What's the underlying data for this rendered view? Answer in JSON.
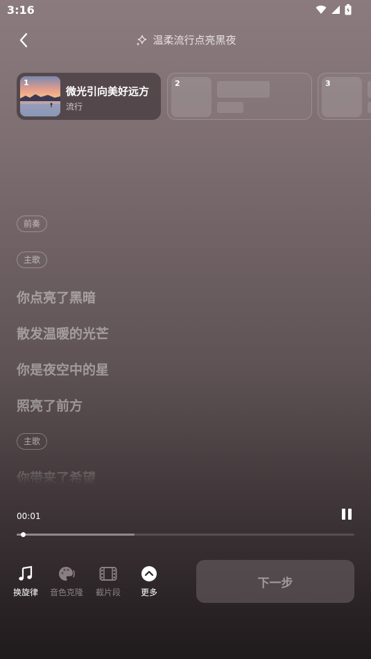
{
  "status_bar": {
    "time": "3:16"
  },
  "header": {
    "title": "温柔流行点亮黑夜"
  },
  "song_cards": [
    {
      "number": "1",
      "title": "微光引向美好远方",
      "genre": "流行"
    },
    {
      "number": "2"
    },
    {
      "number": "3"
    }
  ],
  "lyrics": [
    {
      "type": "tag",
      "text": "前奏"
    },
    {
      "type": "tag",
      "text": "主歌"
    },
    {
      "type": "line",
      "text": "你点亮了黑暗"
    },
    {
      "type": "line",
      "text": "散发温暖的光芒"
    },
    {
      "type": "line",
      "text": "你是夜空中的星"
    },
    {
      "type": "line",
      "text": "照亮了前方"
    },
    {
      "type": "tag",
      "text": "主歌"
    },
    {
      "type": "line",
      "text": "你带来了希望"
    }
  ],
  "player": {
    "current_time": "00:01",
    "progress_fraction": 0.35,
    "playhead_fraction": 0.012
  },
  "toolbar": [
    {
      "label": "换旋律",
      "icon": "music-note-icon",
      "active": true
    },
    {
      "label": "音色克隆",
      "icon": "palette-icon",
      "active": false
    },
    {
      "label": "截片段",
      "icon": "film-icon",
      "active": false
    },
    {
      "label": "更多",
      "icon": "chevron-up-circle-icon",
      "active": true
    }
  ],
  "next_button": {
    "label": "下一步"
  },
  "colors": {
    "active": "#ffffff",
    "inactive": "#8a8083",
    "next_button_bg": "#6e6467"
  }
}
